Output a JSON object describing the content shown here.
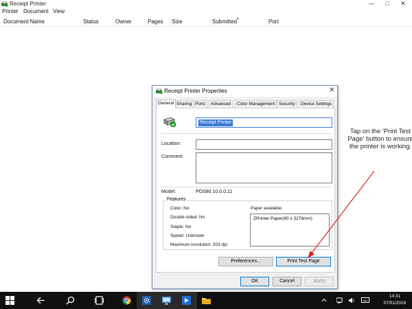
{
  "window": {
    "title": "Receipt Printer",
    "controls": {
      "minimize": "—",
      "maximize": "□",
      "close": "✕"
    }
  },
  "menu": [
    "Printer",
    "Document",
    "View"
  ],
  "columns": [
    "Document Name",
    "Status",
    "Owner",
    "Pages",
    "Size",
    "Submitted",
    "Port"
  ],
  "dialog": {
    "title": "Receipt Printer Properties",
    "close": "✕",
    "tabs": [
      "General",
      "Sharing",
      "Ports",
      "Advanced",
      "Color Management",
      "Security",
      "Device Settings"
    ],
    "active_tab": "General",
    "printer_name": "Receipt Printer",
    "location_label": "Location:",
    "location_value": "",
    "comment_label": "Comment:",
    "comment_value": "",
    "model_label": "Model:",
    "model_value": "POS80 10.0.0.11",
    "features_title": "Features",
    "features": [
      "Color: No",
      "Double-sided: No",
      "Staple: No",
      "Speed: Unknown",
      "Maximum resolution: 203 dpi"
    ],
    "paper_label": "Paper available:",
    "paper_items": [
      "ZPrinter Paper(80 x 3276mm)"
    ],
    "preferences_btn": "Preferences...",
    "test_page_btn": "Print Test Page",
    "ok_btn": "OK",
    "cancel_btn": "Cancel",
    "apply_btn": "Apply"
  },
  "annotation": {
    "text": "Tap on the 'Print Test Page' button to ensure the printer is working."
  },
  "taskbar": {
    "time": "14:31",
    "date": "07/01/2019",
    "icons": [
      "windows-start-icon",
      "back-icon",
      "search-icon",
      "task-view-icon",
      "chrome-icon",
      "settings-icon",
      "display-icon",
      "app-icon",
      "file-explorer-icon"
    ]
  },
  "colors": {
    "accent": "#0078d7",
    "arrow": "#d8241c",
    "taskbar": "#101010"
  }
}
